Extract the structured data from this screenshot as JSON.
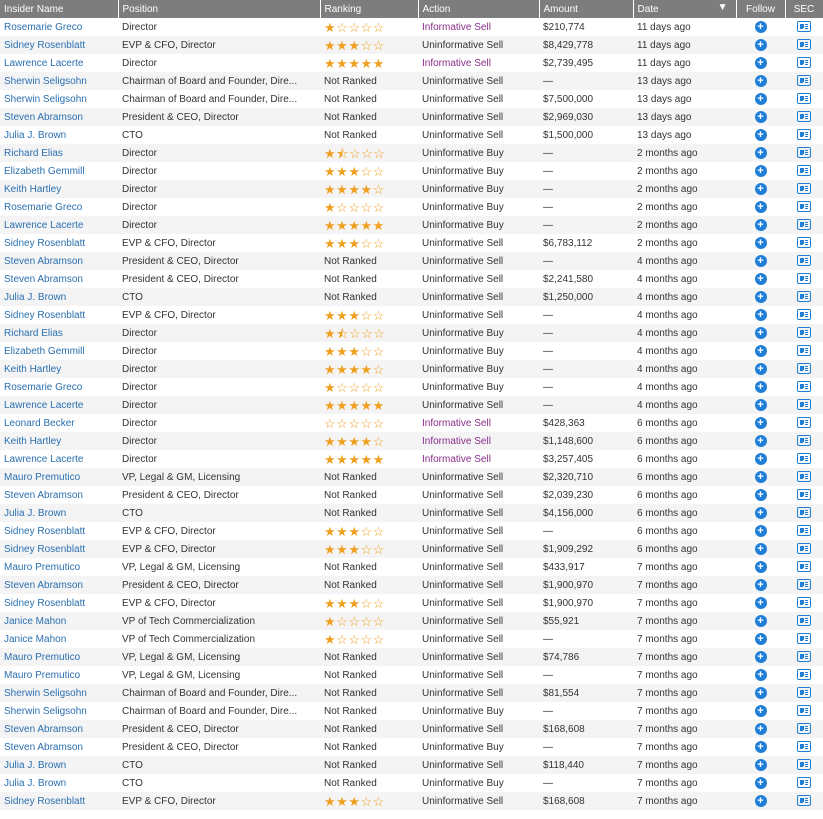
{
  "table": {
    "headers": {
      "insider": "Insider Name",
      "position": "Position",
      "ranking": "Ranking",
      "action": "Action",
      "amount": "Amount",
      "date": "Date",
      "follow": "Follow",
      "sec": "SEC"
    },
    "sort_icon": "▼",
    "rows": [
      {
        "name": "Rosemarie Greco",
        "position": "Director",
        "rank": "stars",
        "stars": 1,
        "action": "Informative Sell",
        "amount": "$210,774",
        "date": "11 days ago"
      },
      {
        "name": "Sidney Rosenblatt",
        "position": "EVP & CFO, Director",
        "rank": "stars",
        "stars": 3,
        "action": "Uninformative Sell",
        "amount": "$8,429,778",
        "date": "11 days ago"
      },
      {
        "name": "Lawrence Lacerte",
        "position": "Director",
        "rank": "stars",
        "stars": 5,
        "action": "Informative Sell",
        "amount": "$2,739,495",
        "date": "11 days ago"
      },
      {
        "name": "Sherwin Seligsohn",
        "position": "Chairman of Board and Founder, Dire...",
        "rank": "Not Ranked",
        "stars": 0,
        "action": "Uninformative Sell",
        "amount": "—",
        "date": "13 days ago"
      },
      {
        "name": "Sherwin Seligsohn",
        "position": "Chairman of Board and Founder, Dire...",
        "rank": "Not Ranked",
        "stars": 0,
        "action": "Uninformative Sell",
        "amount": "$7,500,000",
        "date": "13 days ago"
      },
      {
        "name": "Steven Abramson",
        "position": "President & CEO, Director",
        "rank": "Not Ranked",
        "stars": 0,
        "action": "Uninformative Sell",
        "amount": "$2,969,030",
        "date": "13 days ago"
      },
      {
        "name": "Julia J. Brown",
        "position": "CTO",
        "rank": "Not Ranked",
        "stars": 0,
        "action": "Uninformative Sell",
        "amount": "$1,500,000",
        "date": "13 days ago"
      },
      {
        "name": "Richard Elias",
        "position": "Director",
        "rank": "stars",
        "stars": 1.5,
        "action": "Uninformative Buy",
        "amount": "—",
        "date": "2 months ago"
      },
      {
        "name": "Elizabeth Gemmill",
        "position": "Director",
        "rank": "stars",
        "stars": 3,
        "action": "Uninformative Buy",
        "amount": "—",
        "date": "2 months ago"
      },
      {
        "name": "Keith Hartley",
        "position": "Director",
        "rank": "stars",
        "stars": 4,
        "action": "Uninformative Buy",
        "amount": "—",
        "date": "2 months ago"
      },
      {
        "name": "Rosemarie Greco",
        "position": "Director",
        "rank": "stars",
        "stars": 1,
        "action": "Uninformative Buy",
        "amount": "—",
        "date": "2 months ago"
      },
      {
        "name": "Lawrence Lacerte",
        "position": "Director",
        "rank": "stars",
        "stars": 5,
        "action": "Uninformative Buy",
        "amount": "—",
        "date": "2 months ago"
      },
      {
        "name": "Sidney Rosenblatt",
        "position": "EVP & CFO, Director",
        "rank": "stars",
        "stars": 3,
        "action": "Uninformative Sell",
        "amount": "$6,783,112",
        "date": "2 months ago"
      },
      {
        "name": "Steven Abramson",
        "position": "President & CEO, Director",
        "rank": "Not Ranked",
        "stars": 0,
        "action": "Uninformative Sell",
        "amount": "—",
        "date": "4 months ago"
      },
      {
        "name": "Steven Abramson",
        "position": "President & CEO, Director",
        "rank": "Not Ranked",
        "stars": 0,
        "action": "Uninformative Sell",
        "amount": "$2,241,580",
        "date": "4 months ago"
      },
      {
        "name": "Julia J. Brown",
        "position": "CTO",
        "rank": "Not Ranked",
        "stars": 0,
        "action": "Uninformative Sell",
        "amount": "$1,250,000",
        "date": "4 months ago"
      },
      {
        "name": "Sidney Rosenblatt",
        "position": "EVP & CFO, Director",
        "rank": "stars",
        "stars": 3,
        "action": "Uninformative Sell",
        "amount": "—",
        "date": "4 months ago"
      },
      {
        "name": "Richard Elias",
        "position": "Director",
        "rank": "stars",
        "stars": 1.5,
        "action": "Uninformative Buy",
        "amount": "—",
        "date": "4 months ago"
      },
      {
        "name": "Elizabeth Gemmill",
        "position": "Director",
        "rank": "stars",
        "stars": 3,
        "action": "Uninformative Buy",
        "amount": "—",
        "date": "4 months ago"
      },
      {
        "name": "Keith Hartley",
        "position": "Director",
        "rank": "stars",
        "stars": 4,
        "action": "Uninformative Buy",
        "amount": "—",
        "date": "4 months ago"
      },
      {
        "name": "Rosemarie Greco",
        "position": "Director",
        "rank": "stars",
        "stars": 1,
        "action": "Uninformative Buy",
        "amount": "—",
        "date": "4 months ago"
      },
      {
        "name": "Lawrence Lacerte",
        "position": "Director",
        "rank": "stars",
        "stars": 5,
        "action": "Uninformative Sell",
        "amount": "—",
        "date": "4 months ago"
      },
      {
        "name": "Leonard Becker",
        "position": "Director",
        "rank": "stars",
        "stars": 0,
        "action": "Informative Sell",
        "amount": "$428,363",
        "date": "6 months ago"
      },
      {
        "name": "Keith Hartley",
        "position": "Director",
        "rank": "stars",
        "stars": 4,
        "action": "Informative Sell",
        "amount": "$1,148,600",
        "date": "6 months ago"
      },
      {
        "name": "Lawrence Lacerte",
        "position": "Director",
        "rank": "stars",
        "stars": 5,
        "action": "Informative Sell",
        "amount": "$3,257,405",
        "date": "6 months ago"
      },
      {
        "name": "Mauro Premutico",
        "position": "VP, Legal & GM, Licensing",
        "rank": "Not Ranked",
        "stars": 0,
        "action": "Uninformative Sell",
        "amount": "$2,320,710",
        "date": "6 months ago"
      },
      {
        "name": "Steven Abramson",
        "position": "President & CEO, Director",
        "rank": "Not Ranked",
        "stars": 0,
        "action": "Uninformative Sell",
        "amount": "$2,039,230",
        "date": "6 months ago"
      },
      {
        "name": "Julia J. Brown",
        "position": "CTO",
        "rank": "Not Ranked",
        "stars": 0,
        "action": "Uninformative Sell",
        "amount": "$4,156,000",
        "date": "6 months ago"
      },
      {
        "name": "Sidney Rosenblatt",
        "position": "EVP & CFO, Director",
        "rank": "stars",
        "stars": 3,
        "action": "Uninformative Sell",
        "amount": "—",
        "date": "6 months ago"
      },
      {
        "name": "Sidney Rosenblatt",
        "position": "EVP & CFO, Director",
        "rank": "stars",
        "stars": 3,
        "action": "Uninformative Sell",
        "amount": "$1,909,292",
        "date": "6 months ago"
      },
      {
        "name": "Mauro Premutico",
        "position": "VP, Legal & GM, Licensing",
        "rank": "Not Ranked",
        "stars": 0,
        "action": "Uninformative Sell",
        "amount": "$433,917",
        "date": "7 months ago"
      },
      {
        "name": "Steven Abramson",
        "position": "President & CEO, Director",
        "rank": "Not Ranked",
        "stars": 0,
        "action": "Uninformative Sell",
        "amount": "$1,900,970",
        "date": "7 months ago"
      },
      {
        "name": "Sidney Rosenblatt",
        "position": "EVP & CFO, Director",
        "rank": "stars",
        "stars": 3,
        "action": "Uninformative Sell",
        "amount": "$1,900,970",
        "date": "7 months ago"
      },
      {
        "name": "Janice Mahon",
        "position": "VP of Tech Commercialization",
        "rank": "stars",
        "stars": 1,
        "action": "Uninformative Sell",
        "amount": "$55,921",
        "date": "7 months ago"
      },
      {
        "name": "Janice Mahon",
        "position": "VP of Tech Commercialization",
        "rank": "stars",
        "stars": 1,
        "action": "Uninformative Sell",
        "amount": "—",
        "date": "7 months ago"
      },
      {
        "name": "Mauro Premutico",
        "position": "VP, Legal & GM, Licensing",
        "rank": "Not Ranked",
        "stars": 0,
        "action": "Uninformative Sell",
        "amount": "$74,786",
        "date": "7 months ago"
      },
      {
        "name": "Mauro Premutico",
        "position": "VP, Legal & GM, Licensing",
        "rank": "Not Ranked",
        "stars": 0,
        "action": "Uninformative Sell",
        "amount": "—",
        "date": "7 months ago"
      },
      {
        "name": "Sherwin Seligsohn",
        "position": "Chairman of Board and Founder, Dire...",
        "rank": "Not Ranked",
        "stars": 0,
        "action": "Uninformative Sell",
        "amount": "$81,554",
        "date": "7 months ago"
      },
      {
        "name": "Sherwin Seligsohn",
        "position": "Chairman of Board and Founder, Dire...",
        "rank": "Not Ranked",
        "stars": 0,
        "action": "Uninformative Buy",
        "amount": "—",
        "date": "7 months ago"
      },
      {
        "name": "Steven Abramson",
        "position": "President & CEO, Director",
        "rank": "Not Ranked",
        "stars": 0,
        "action": "Uninformative Sell",
        "amount": "$168,608",
        "date": "7 months ago"
      },
      {
        "name": "Steven Abramson",
        "position": "President & CEO, Director",
        "rank": "Not Ranked",
        "stars": 0,
        "action": "Uninformative Buy",
        "amount": "—",
        "date": "7 months ago"
      },
      {
        "name": "Julia J. Brown",
        "position": "CTO",
        "rank": "Not Ranked",
        "stars": 0,
        "action": "Uninformative Sell",
        "amount": "$118,440",
        "date": "7 months ago"
      },
      {
        "name": "Julia J. Brown",
        "position": "CTO",
        "rank": "Not Ranked",
        "stars": 0,
        "action": "Uninformative Buy",
        "amount": "—",
        "date": "7 months ago"
      },
      {
        "name": "Sidney Rosenblatt",
        "position": "EVP & CFO, Director",
        "rank": "stars",
        "stars": 3,
        "action": "Uninformative Sell",
        "amount": "$168,608",
        "date": "7 months ago"
      }
    ]
  },
  "icons": {
    "follow": "plus-circle-icon",
    "sec": "document-icon",
    "star": "star-icon"
  },
  "colors": {
    "header_bg": "#7d7d7d",
    "name_link": "#2a6fb0",
    "informative": "#8b2d8b",
    "star": "#f0a020",
    "icon_blue": "#1f7fd6",
    "row_alt": "#f4f4f4"
  }
}
